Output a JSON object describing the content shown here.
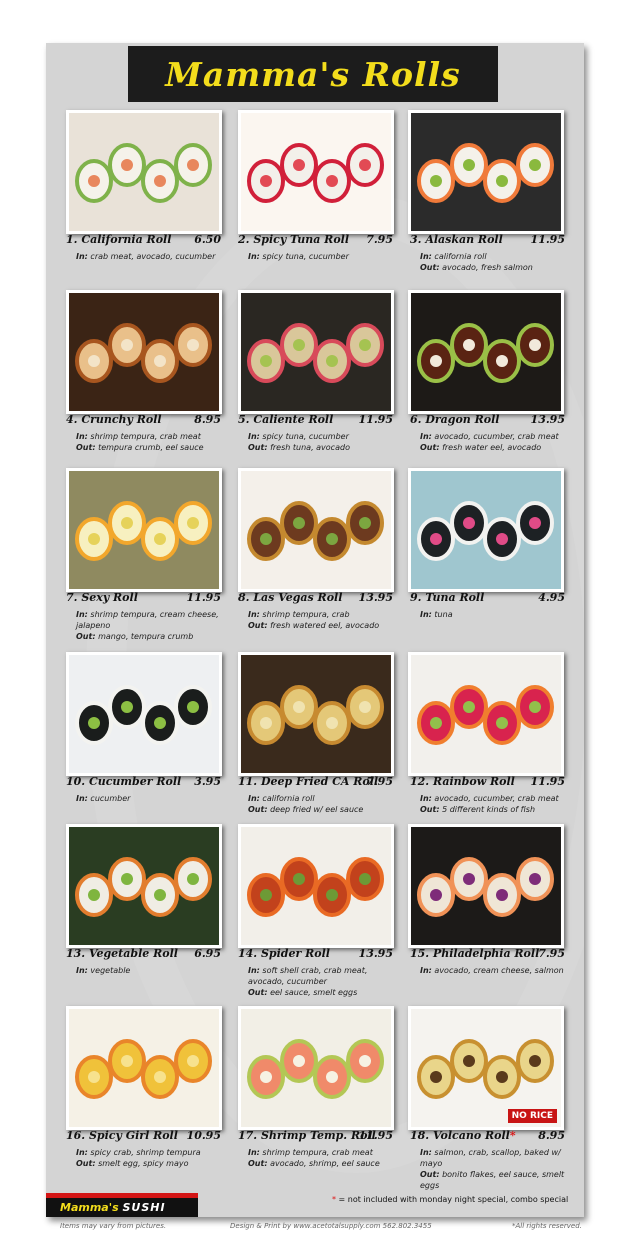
{
  "title": "Mamma's Rolls",
  "items": [
    {
      "name": "1. California Roll",
      "price": "6.50",
      "in": "crab meat, avocado, cucumber",
      "out": "",
      "palette": [
        "#e9e2d8",
        "#f5f2ea",
        "#7fb24a",
        "#e8875d"
      ]
    },
    {
      "name": "2. Spicy Tuna Roll",
      "price": "7.95",
      "in": "spicy tuna, cucumber",
      "out": "",
      "palette": [
        "#fbf6f0",
        "#f3f0ea",
        "#d1203a",
        "#e24a54"
      ]
    },
    {
      "name": "3. Alaskan Roll",
      "price": "11.95",
      "in": "california roll",
      "out": "avocado, fresh salmon",
      "palette": [
        "#2b2b2b",
        "#f4f1ea",
        "#f07a3a",
        "#8ab93e"
      ]
    },
    {
      "name": "4. Crunchy Roll",
      "price": "8.95",
      "in": "shrimp tempura, crab meat",
      "out": "tempura crumb, eel sauce",
      "palette": [
        "#3b2415",
        "#e9c08a",
        "#a8561f",
        "#f3e4c8"
      ]
    },
    {
      "name": "5. Caliente Roll",
      "price": "11.95",
      "in": "spicy tuna, cucumber",
      "out": "fresh tuna, avocado",
      "palette": [
        "#2a2722",
        "#d9c79a",
        "#d84a5a",
        "#a5c351"
      ]
    },
    {
      "name": "6. Dragon Roll",
      "price": "13.95",
      "in": "avocado, cucumber, crab meat",
      "out": "fresh water eel, avocado",
      "palette": [
        "#1d1a17",
        "#5a2313",
        "#9ac047",
        "#f1e9db"
      ]
    },
    {
      "name": "7. Sexy Roll",
      "price": "11.95",
      "in": "shrimp tempura, cream cheese, jalapeno",
      "out": "mango, tempura crumb",
      "palette": [
        "#8f8a60",
        "#f7f0c0",
        "#f2a72c",
        "#e6d25a"
      ]
    },
    {
      "name": "8.  Las Vegas Roll",
      "price": "13.95",
      "in": "shrimp tempura, crab",
      "out": "fresh watered eel, avocado",
      "palette": [
        "#f4f0ea",
        "#6d3a1f",
        "#c4892f",
        "#7ca640"
      ]
    },
    {
      "name": "9. Tuna Roll",
      "price": "4.95",
      "in": "tuna",
      "out": "",
      "palette": [
        "#9fc6cf",
        "#1d2124",
        "#f2f2f0",
        "#e04b87"
      ]
    },
    {
      "name": "10. Cucumber Roll",
      "price": "3.95",
      "in": "cucumber",
      "out": "",
      "palette": [
        "#eef0f2",
        "#1a1d1c",
        "#f3f3f0",
        "#8cbf43"
      ]
    },
    {
      "name": "11. Deep Fried CA Roll",
      "price": "7.95",
      "in": "california roll",
      "out": "deep fried w/ eel sauce",
      "palette": [
        "#3a2a1c",
        "#e4c878",
        "#c78a30",
        "#f0e3b0"
      ]
    },
    {
      "name": "12. Rainbow Roll",
      "price": "11.95",
      "in": "avocado, cucumber, crab meat",
      "out": "5 different kinds of fish",
      "palette": [
        "#f2f0ec",
        "#d8234e",
        "#f07e2e",
        "#92c04b"
      ]
    },
    {
      "name": "13. Vegetable Roll",
      "price": "6.95",
      "in": "vegetable",
      "out": "",
      "palette": [
        "#2a3d22",
        "#f0ede4",
        "#e27d2e",
        "#7fb53f"
      ]
    },
    {
      "name": "14. Spider Roll",
      "price": "13.95",
      "in": "soft shell crab, crab meat, avocado, cucumber",
      "out": "eel sauce, smelt eggs",
      "palette": [
        "#f2efe9",
        "#c2421c",
        "#e96a24",
        "#6d9a36"
      ]
    },
    {
      "name": "15. Philadelphia Roll",
      "price": "7.95",
      "in": "avocado, cream cheese, salmon",
      "out": "",
      "palette": [
        "#1c1a18",
        "#efe6d6",
        "#f09257",
        "#7e2c79"
      ]
    },
    {
      "name": "16. Spicy Girl Roll",
      "price": "10.95",
      "in": "spicy crab, shrimp tempura",
      "out": "smelt egg, spicy mayo",
      "palette": [
        "#f5f1e6",
        "#f0c23a",
        "#e9852a",
        "#f7e28e"
      ]
    },
    {
      "name": "17. Shrimp Temp. Roll",
      "price": "11.95",
      "in": "shrimp tempura, crab meat",
      "out": "avocado, shrimp, eel sauce",
      "palette": [
        "#f2efe6",
        "#f08a6a",
        "#b3c755",
        "#f6f2e3"
      ]
    },
    {
      "name": "18. Volcano Roll",
      "price": "8.95",
      "asterisk": "*",
      "in": "salmon, crab, scallop, baked w/ mayo",
      "out": "bonito flakes, eel sauce, smelt eggs",
      "palette": [
        "#f5f3ef",
        "#e9d58a",
        "#c89030",
        "#5a3a1c"
      ],
      "badge": "NO RICE"
    }
  ],
  "labels": {
    "in": "In:",
    "out": "Out:"
  },
  "brand": {
    "part1": "Mamma's",
    "part2": "SUSHI"
  },
  "footnote": {
    "star": "*",
    "text": " = not included with monday night special, combo special"
  },
  "footer": {
    "left": "Items may vary from pictures.",
    "center": "Design & Print  by www.acetotalsupply.com 562.802.3455",
    "right": "*All rights reserved."
  },
  "colors": {
    "title": "#f3dd1c",
    "board": "#d4d4d4",
    "accent": "#d31515"
  }
}
